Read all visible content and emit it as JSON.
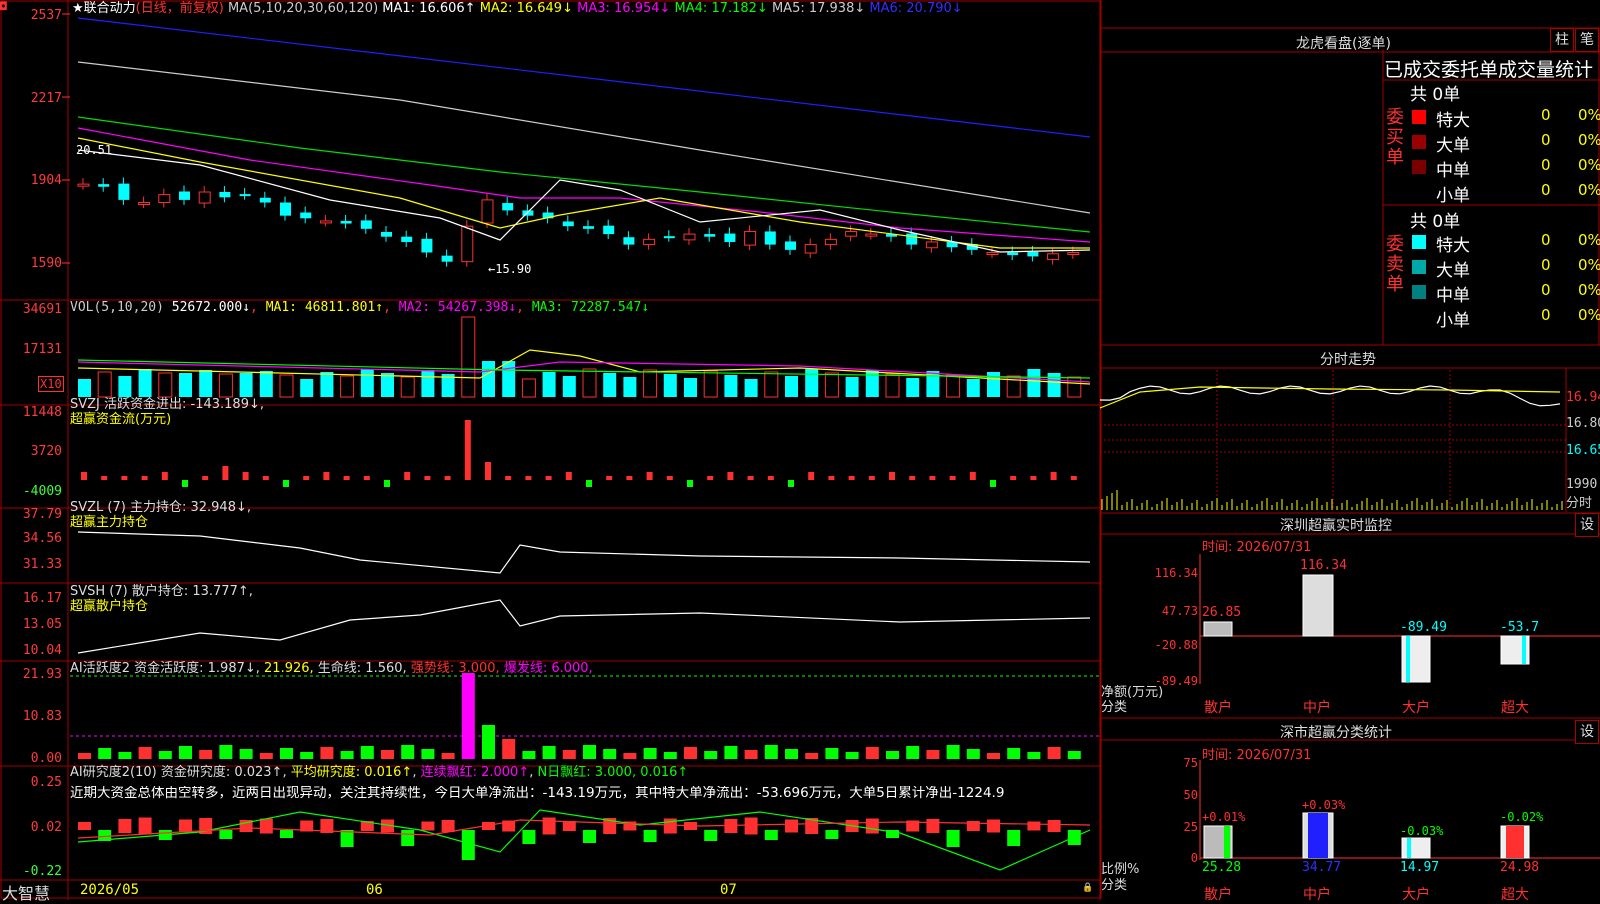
{
  "stock": {
    "star": "★",
    "name": "联合动力",
    "period": "(日线，前复权)"
  },
  "main_ma": {
    "label": "MA(5,10,20,30,60,120)",
    "ma1": "MA1: 16.606↑",
    "ma2": "MA2: 16.649↓",
    "ma3": "MA3: 16.954↓",
    "ma4": "MA4: 17.182↓",
    "ma5": "MA5: 17.938↓",
    "ma6": "MA6: 20.790↓",
    "axis": [
      "2537",
      "2217",
      "1904",
      "1590"
    ],
    "high_note": "20.51",
    "low_note": "←15.90"
  },
  "vol": {
    "label": "VOL(5,10,20)",
    "value": "52672.000↓",
    "ma1": "MA1: 46811.801↑",
    "ma2": "MA2: 54267.398↓",
    "ma3": "MA3: 72287.547↓",
    "axis": [
      "34691",
      "17131"
    ],
    "unit": "X10"
  },
  "svzj": {
    "title": "SVZJ  活跃资金进出: -143.189↓,",
    "sub": "超赢资金流(万元)",
    "axis": [
      "11448",
      "3720",
      "-4009"
    ]
  },
  "svzl": {
    "title": "SVZL (7) 主力持仓: 32.948↓,",
    "sub": "超赢主力持仓",
    "axis": [
      "37.79",
      "34.56",
      "31.33"
    ]
  },
  "svsh": {
    "title": "SVSH (7) 散户持仓: 13.777↑,",
    "sub": "超赢散户持仓",
    "axis": [
      "16.17",
      "13.05",
      "10.04"
    ]
  },
  "ai1": {
    "title": "AI活跃度2 资金活跃度: 1.987↓,",
    "v2": "21.926,",
    "v3": "生命线: 1.560,",
    "v4": "强势线: 3.000,",
    "v5": "爆发线: 6.000,",
    "axis": [
      "21.93",
      "10.83",
      "0.00"
    ]
  },
  "ai2": {
    "title": "AI研究度2(10) 资金研究度: 0.023↑",
    "avg": "平均研究度: 0.016↑",
    "lx": "连续飘红: 2.000↑",
    "nr": "N日飘红: 3.000, 0.016↑",
    "desc": "近期大资金总体由空转多，近两日出现异动，关注其持续性，今日大单净流出：-143.19万元，其中特大单净流出：-53.696万元，大单5日累计净出-1224.9",
    "axis": [
      "0.25",
      "0.02",
      "-0.22"
    ]
  },
  "xaxis": {
    "brand": "大智慧",
    "d1": "2026/05",
    "d2": "06",
    "d3": "07"
  },
  "dragon": {
    "title": "龙虎看盘(逐单)",
    "btn_zhu": "柱",
    "btn_bi": "笔",
    "tabs": "已成交委托单成交量统计",
    "buy_label": "委买单",
    "sell_label": "委卖单",
    "buy_total": "共 0单",
    "sell_total": "共 0单",
    "buy_rows": [
      {
        "name": "特大",
        "n": "0",
        "p": "0%",
        "color": "#ff0000"
      },
      {
        "name": "大单",
        "n": "0",
        "p": "0%",
        "color": "#9a0000"
      },
      {
        "name": "中单",
        "n": "0",
        "p": "0%",
        "color": "#7a0000"
      },
      {
        "name": "小单",
        "n": "0",
        "p": "0%",
        "color": "#000000"
      }
    ],
    "sell_rows": [
      {
        "name": "特大",
        "n": "0",
        "p": "0%",
        "color": "#00ffff"
      },
      {
        "name": "大单",
        "n": "0",
        "p": "0%",
        "color": "#00a8a8"
      },
      {
        "name": "中单",
        "n": "0",
        "p": "0%",
        "color": "#008080"
      },
      {
        "name": "小单",
        "n": "0",
        "p": "0%",
        "color": "#000000"
      }
    ]
  },
  "fenshi": {
    "title": "分时走势",
    "y1": "16.94",
    "y2": "16.80",
    "y3": "16.65",
    "vol": "1990",
    "lbl": "分时"
  },
  "monitor": {
    "title": "深圳超赢实时监控",
    "btn": "设",
    "time": "时间: 2026/07/31",
    "axis": [
      "116.34",
      "47.73",
      "-20.88",
      "-89.49"
    ],
    "unit": "净额(万元)",
    "cls": "分类",
    "cats": [
      "散户",
      "中户",
      "大户",
      "超大"
    ],
    "values": [
      "26.85",
      "116.34",
      "-89.49",
      "-53.7"
    ]
  },
  "classify": {
    "title": "深市超赢分类统计",
    "btn": "设",
    "time": "时间: 2026/07/31",
    "axis": [
      "75",
      "50",
      "25",
      "0"
    ],
    "unit": "比例%",
    "cls": "分类",
    "cats": [
      "散户",
      "中户",
      "大户",
      "超大"
    ],
    "changes": [
      "+0.01%",
      "+0.03%",
      "-0.03%",
      "-0.02%"
    ],
    "values": [
      "25.28",
      "34.77",
      "14.97",
      "24.98"
    ]
  },
  "colors": {
    "up": "#ff3030",
    "down": "#00ffff",
    "grid": "#a00000"
  }
}
